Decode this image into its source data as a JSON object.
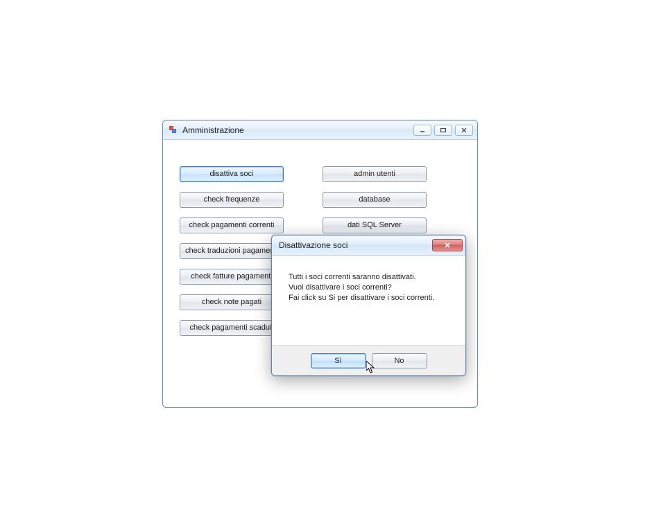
{
  "mainWindow": {
    "title": "Amministrazione",
    "leftButtons": [
      "disattiva soci",
      "check frequenze",
      "check pagamenti correnti",
      "check traduzioni pagamenti",
      "check fatture pagamenti",
      "check note pagati",
      "check pagamenti scaduti"
    ],
    "rightButtons": [
      "admin utenti",
      "database",
      "dati SQL Server"
    ],
    "focusedLeftIndex": 0
  },
  "dialog": {
    "title": "Disattivazione soci",
    "message": {
      "line1": "Tutti i soci correnti saranno disattivati.",
      "line2": "Vuoi disattivare i soci correnti?",
      "line3": "Fai click su Si per disattivare i soci correnti."
    },
    "yesLabel": "Sì",
    "noLabel": "No"
  }
}
